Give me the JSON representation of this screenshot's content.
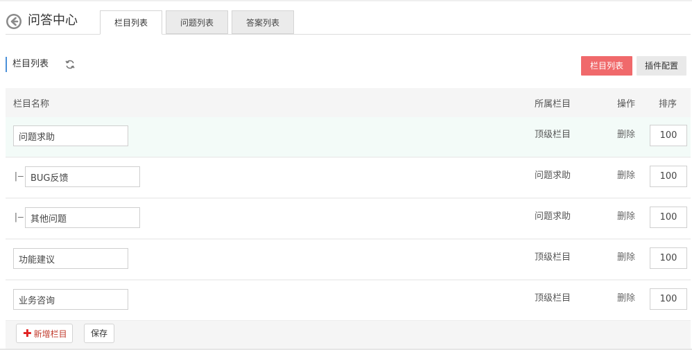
{
  "header": {
    "title": "问答中心",
    "tabs": [
      {
        "label": "栏目列表",
        "active": true
      },
      {
        "label": "问题列表",
        "active": false
      },
      {
        "label": "答案列表",
        "active": false
      }
    ]
  },
  "section": {
    "title": "栏目列表",
    "refresh_icon": "refresh-icon",
    "buttons": {
      "list_label": "栏目列表",
      "config_label": "插件配置"
    }
  },
  "table": {
    "columns": {
      "name": "栏目名称",
      "parent": "所属栏目",
      "action": "操作",
      "sort": "排序"
    },
    "rows": [
      {
        "prefix": "",
        "name": "问题求助",
        "parent": "顶级栏目",
        "action": "删除",
        "sort": "100"
      },
      {
        "prefix": "|—",
        "name": "BUG反馈",
        "parent": "问题求助",
        "action": "删除",
        "sort": "100"
      },
      {
        "prefix": "|—",
        "name": "其他问题",
        "parent": "问题求助",
        "action": "删除",
        "sort": "100"
      },
      {
        "prefix": "",
        "name": "功能建议",
        "parent": "顶级栏目",
        "action": "删除",
        "sort": "100"
      },
      {
        "prefix": "",
        "name": "业务咨询",
        "parent": "顶级栏目",
        "action": "删除",
        "sort": "100"
      }
    ]
  },
  "footer": {
    "add_label": "新增栏目",
    "save_label": "保存"
  },
  "colors": {
    "accent_red": "#f0696b",
    "section_bar": "#4a90d9",
    "first_row_bg": "#f3fbf8"
  }
}
